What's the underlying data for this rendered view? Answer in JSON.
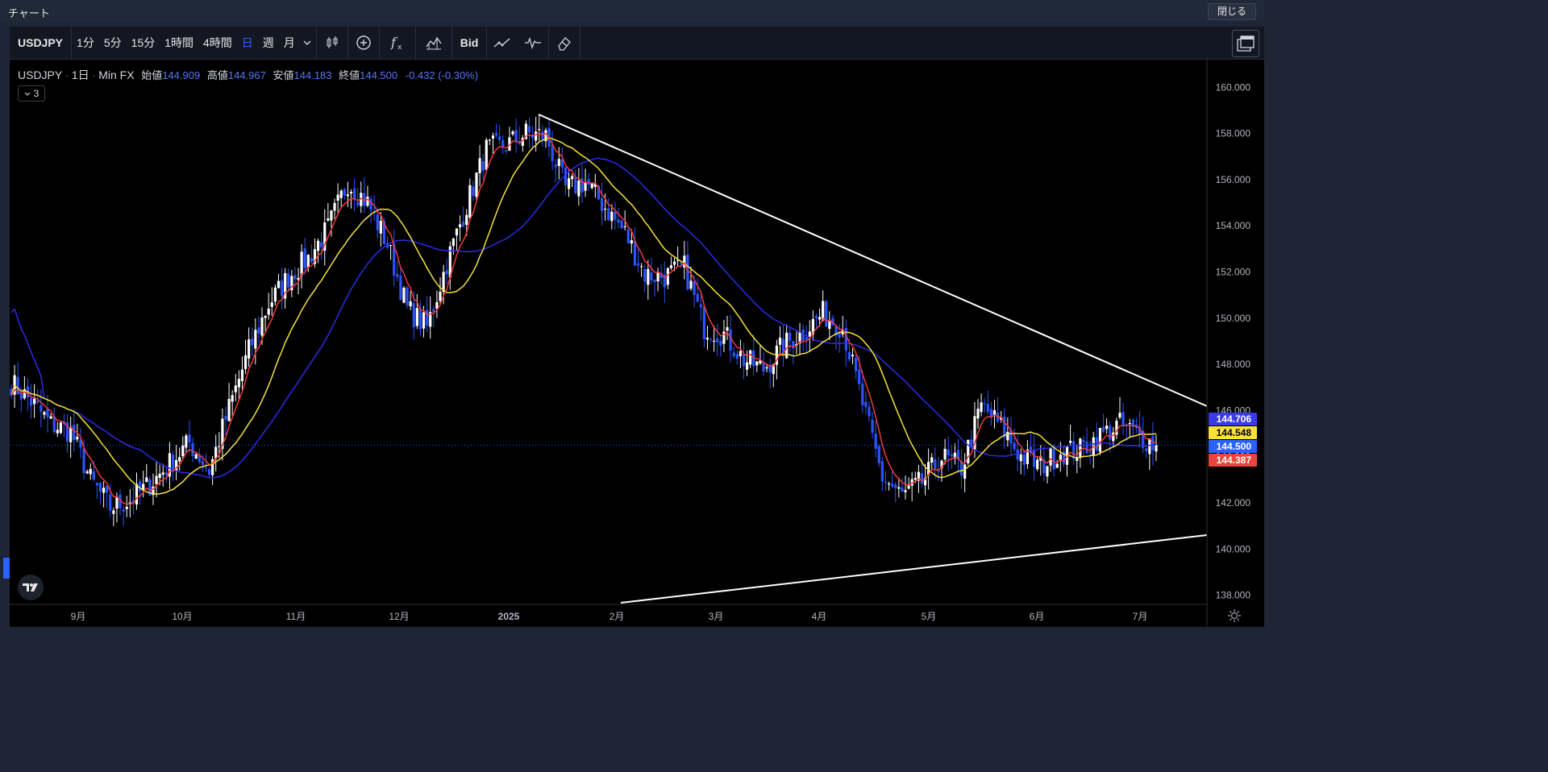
{
  "window": {
    "title": "チャート",
    "close_label": "閉じる"
  },
  "toolbar": {
    "symbol": "USDJPY",
    "intervals": [
      "1分",
      "5分",
      "15分",
      "1時間",
      "4時間",
      "日",
      "週",
      "月"
    ],
    "active_interval": "日",
    "icons": [
      "candles-icon",
      "add-compare-icon",
      "indicators-icon",
      "templates-icon"
    ],
    "price_type": "Bid",
    "icons2": [
      "line-tool-icon",
      "replay-icon",
      "eraser-icon"
    ],
    "layout_icon": "layout-icon"
  },
  "legend": {
    "symbol": "USDJPY",
    "interval": "1日",
    "source": "Min FX",
    "open_label": "始値",
    "open": "144.909",
    "high_label": "高値",
    "high": "144.967",
    "low_label": "安値",
    "low": "144.183",
    "close_label": "終値",
    "close": "144.500",
    "change": "-0.432 (-0.30%)",
    "indicators_count": "3"
  },
  "chart_data": {
    "type": "candlestick",
    "y_axis": {
      "ticks": [
        "160.000",
        "158.000",
        "156.000",
        "154.000",
        "152.000",
        "150.000",
        "148.000",
        "146.000",
        "144.000",
        "142.000",
        "140.000",
        "138.000"
      ],
      "range": [
        137.6,
        161.2
      ]
    },
    "x_axis": {
      "ticks": [
        "9月",
        "10月",
        "11月",
        "12月",
        "2025",
        "2月",
        "3月",
        "4月",
        "5月",
        "6月",
        "7月"
      ]
    },
    "price_labels": [
      {
        "value": "144.706",
        "color": "#3a3ae8",
        "text_color": "#ffffff"
      },
      {
        "value": "144.548",
        "color": "#f7e13a",
        "text_color": "#000000"
      },
      {
        "value": "144.500",
        "color": "#2962ff",
        "text_color": "#ffffff"
      },
      {
        "value": "144.387",
        "color": "#e8453c",
        "text_color": "#ffffff"
      }
    ],
    "last_price": 144.5,
    "colors": {
      "up": "#ffffff",
      "down": "#2b54ff",
      "ma_fast": "#f0393b",
      "ma_mid": "#f7e13a",
      "ma_slow": "#2b2be8",
      "trendline": "#ffffff"
    },
    "anchor_closes": [
      [
        0,
        147.2
      ],
      [
        6,
        146.4
      ],
      [
        12,
        145.4
      ],
      [
        18,
        145.1
      ],
      [
        24,
        143.0
      ],
      [
        30,
        141.8
      ],
      [
        36,
        142.1
      ],
      [
        42,
        142.8
      ],
      [
        48,
        143.7
      ],
      [
        54,
        144.6
      ],
      [
        60,
        143.4
      ],
      [
        66,
        146.1
      ],
      [
        72,
        148.6
      ],
      [
        78,
        150.6
      ],
      [
        84,
        151.8
      ],
      [
        90,
        152.6
      ],
      [
        96,
        153.9
      ],
      [
        102,
        155.9
      ],
      [
        108,
        155.0
      ],
      [
        114,
        153.2
      ],
      [
        120,
        150.4
      ],
      [
        126,
        149.6
      ],
      [
        132,
        152.4
      ],
      [
        138,
        154.9
      ],
      [
        144,
        157.3
      ],
      [
        150,
        157.5
      ],
      [
        156,
        158.0
      ],
      [
        162,
        157.9
      ],
      [
        168,
        155.6
      ],
      [
        174,
        155.9
      ],
      [
        180,
        154.8
      ],
      [
        186,
        153.7
      ],
      [
        192,
        151.9
      ],
      [
        198,
        151.8
      ],
      [
        204,
        152.2
      ],
      [
        210,
        149.6
      ],
      [
        216,
        149.3
      ],
      [
        222,
        148.2
      ],
      [
        228,
        147.8
      ],
      [
        234,
        148.8
      ],
      [
        240,
        149.4
      ],
      [
        246,
        150.2
      ],
      [
        252,
        149.6
      ],
      [
        258,
        146.3
      ],
      [
        264,
        143.1
      ],
      [
        270,
        142.3
      ],
      [
        276,
        142.9
      ],
      [
        282,
        144.0
      ],
      [
        288,
        143.5
      ],
      [
        294,
        146.2
      ],
      [
        300,
        145.3
      ],
      [
        306,
        144.0
      ],
      [
        312,
        143.6
      ],
      [
        318,
        144.2
      ],
      [
        324,
        144.3
      ],
      [
        330,
        144.9
      ],
      [
        336,
        145.4
      ],
      [
        342,
        144.9
      ],
      [
        347,
        144.5
      ]
    ],
    "trendlines": [
      {
        "from": [
          "2025-01-10",
          158.9
        ],
        "to": [
          "2025-07-10",
          146.3
        ]
      },
      {
        "from": [
          "2025-02-01",
          137.6
        ],
        "to": [
          "2025-07-10",
          140.6
        ]
      }
    ]
  }
}
